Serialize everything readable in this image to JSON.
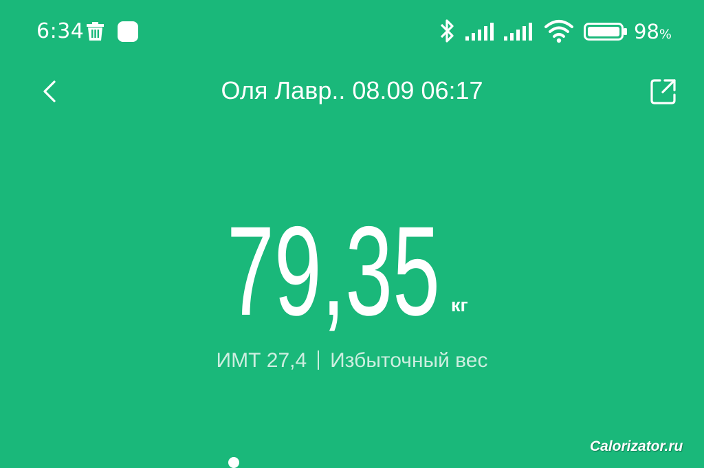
{
  "status_bar": {
    "time": "6:34",
    "battery_percent": "98",
    "battery_unit": "%",
    "battery_level": 0.98,
    "icons": [
      "trash-icon",
      "app-square-icon",
      "bluetooth-icon",
      "signal-icon",
      "signal-icon",
      "wifi-icon",
      "battery-icon"
    ]
  },
  "header": {
    "title": "Оля Лавр.. 08.09 06:17",
    "back_icon": "chevron-left-icon",
    "share_icon": "share-icon"
  },
  "measurement": {
    "weight": "79,35",
    "unit": "кг",
    "bmi_label": "ИМТ 27,4",
    "bmi_category": "Избыточный вес"
  },
  "watermark": "Calorizator.ru",
  "colors": {
    "background": "#1ab87a",
    "text": "#ffffff",
    "secondary_text": "#cdeee0"
  }
}
